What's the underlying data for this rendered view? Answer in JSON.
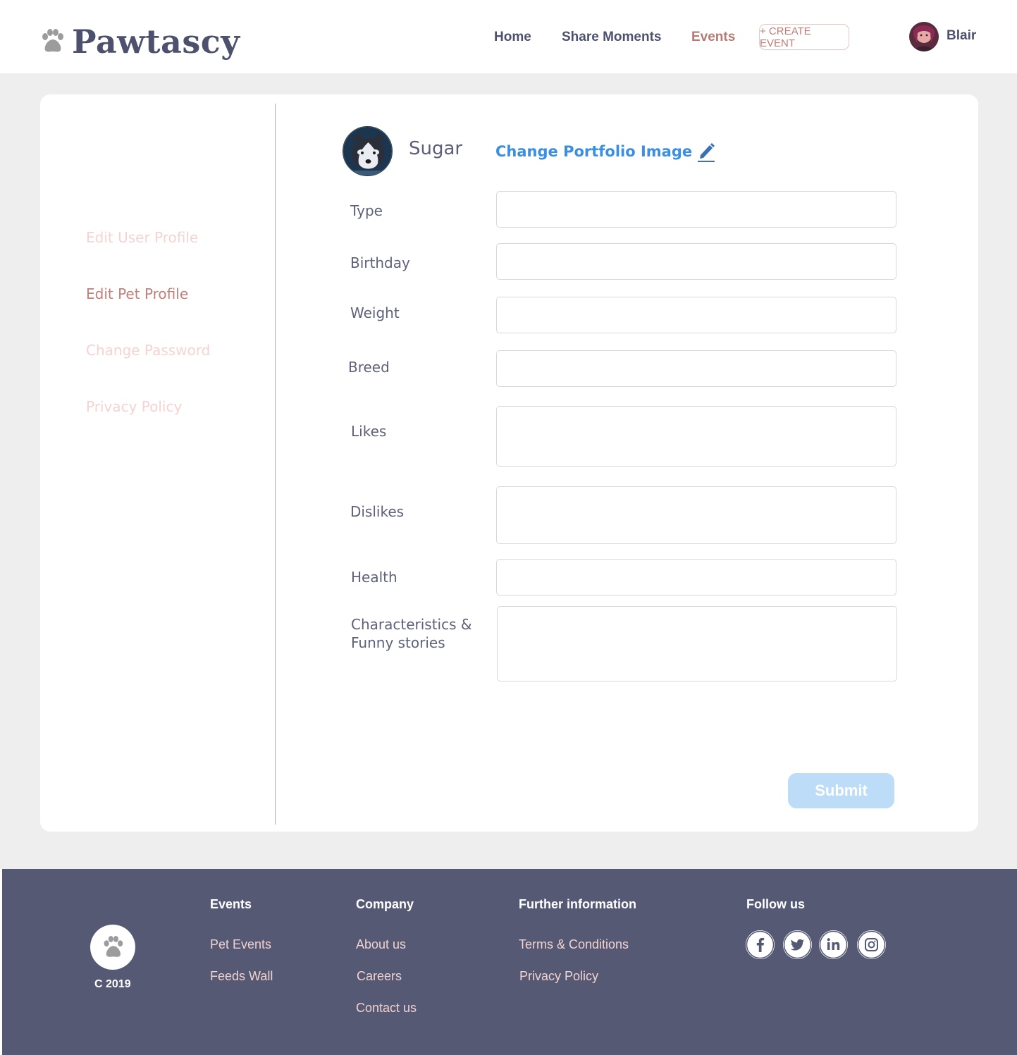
{
  "header": {
    "brand": "Pawtascy",
    "nav": {
      "home": "Home",
      "share": "Share Moments",
      "events": "Events"
    },
    "create_event": "+ CREATE EVENT",
    "user_name": "Blair"
  },
  "sidebar": {
    "items": [
      "Edit User Profile",
      "Edit Pet Profile",
      "Change Password",
      "Privacy Policy"
    ],
    "active": "Edit Pet Profile"
  },
  "pet": {
    "name": "Sugar",
    "change_image": "Change Portfolio Image"
  },
  "form": {
    "fields": [
      {
        "label": "Type",
        "value": ""
      },
      {
        "label": "Birthday",
        "value": ""
      },
      {
        "label": "Weight",
        "value": ""
      },
      {
        "label": "Breed",
        "value": ""
      },
      {
        "label": "Likes",
        "value": ""
      },
      {
        "label": "Dislikes",
        "value": ""
      },
      {
        "label": "Health",
        "value": ""
      },
      {
        "label": "Characteristics &",
        "label_line2": "Funny stories",
        "value": ""
      }
    ],
    "submit": "Submit"
  },
  "footer": {
    "copyright": "C 2019",
    "columns": [
      {
        "heading": "Events",
        "links": [
          "Pet Events",
          "Feeds Wall"
        ]
      },
      {
        "heading": "Company",
        "links": [
          "About us",
          "Careers",
          "Contact us"
        ]
      },
      {
        "heading": "Further information",
        "links": [
          "Terms & Conditions",
          "Privacy Policy"
        ]
      },
      {
        "heading": "Follow us",
        "links": []
      }
    ],
    "social_icons": [
      "facebook-icon",
      "twitter-icon",
      "linkedin-icon",
      "instagram-icon"
    ]
  },
  "colors": {
    "brand_navy": "#4d516d",
    "accent_rose": "#c07f79",
    "link_blue": "#3b8fe1",
    "submit_disabled": "#bddcf7",
    "footer_bg": "#555974"
  }
}
